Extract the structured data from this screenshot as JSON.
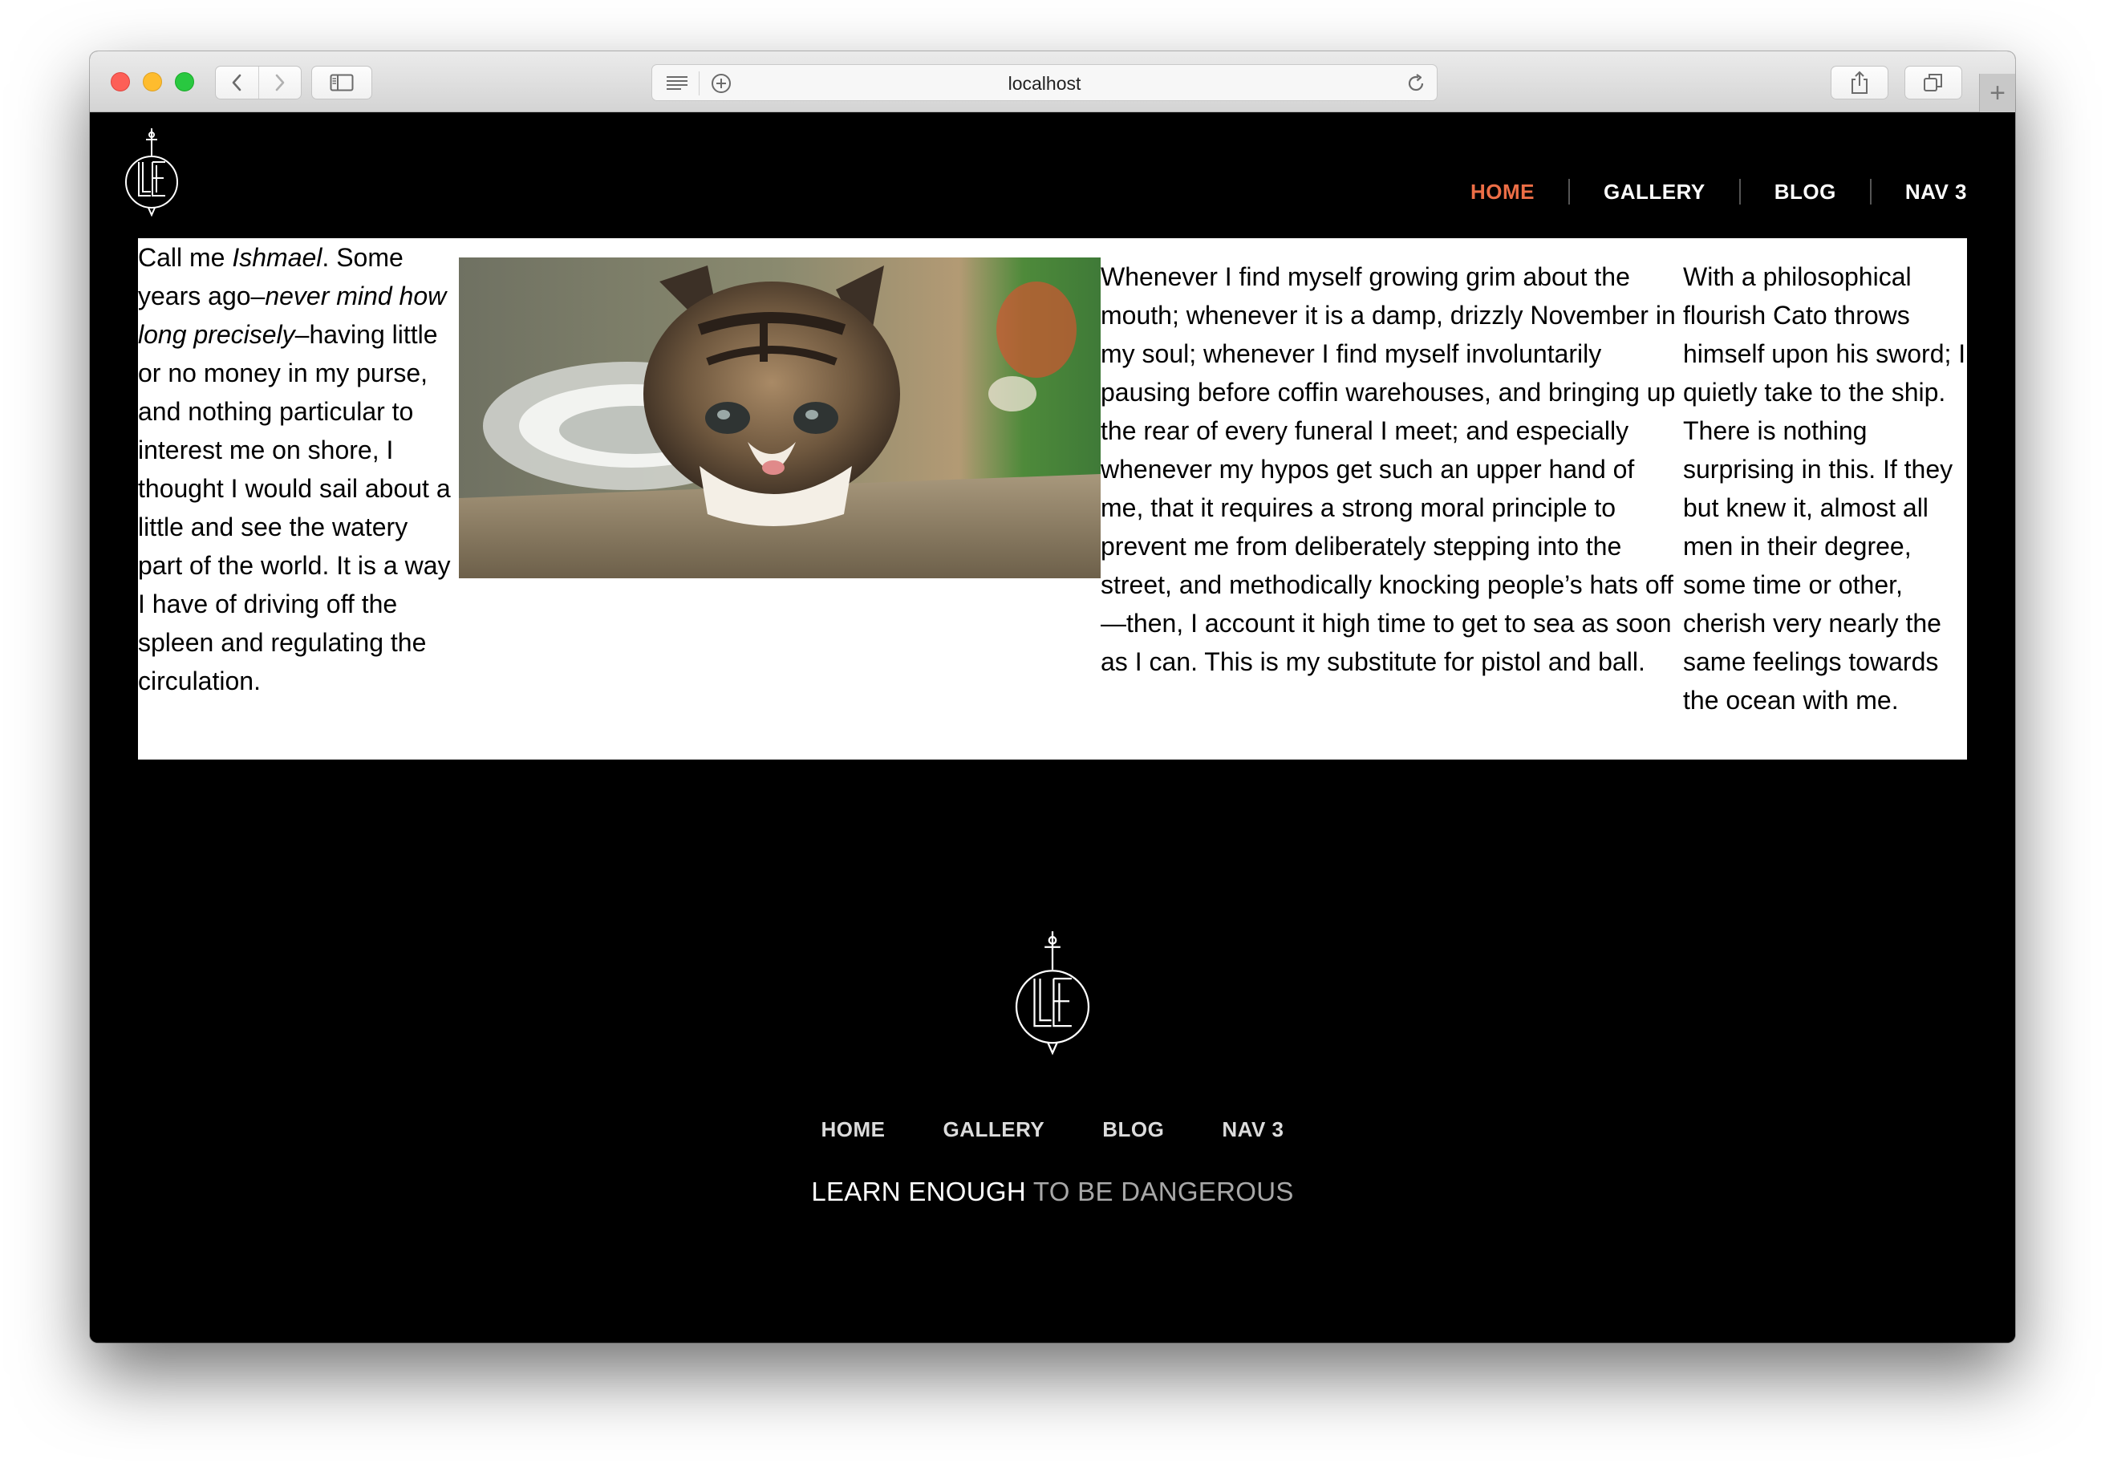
{
  "browser": {
    "url": "localhost",
    "new_tab_label": "+"
  },
  "header": {
    "logo_icon": "le-dagger-logo-icon",
    "nav": [
      {
        "label": "HOME",
        "active": true
      },
      {
        "label": "GALLERY",
        "active": false
      },
      {
        "label": "BLOG",
        "active": false
      },
      {
        "label": "NAV 3",
        "active": false
      }
    ],
    "active_color": "#ed6e46"
  },
  "content": {
    "col1": {
      "p1": "Call me ",
      "p_italic1": "Ishmael",
      "p2": ". Some years ago–",
      "p_italic2": "never mind how long precisely",
      "p3": "–having little or no money in my purse, and nothing particular to interest me on shore, I thought I would sail about a little and see the watery part of the world. It is a way I have of driving off the spleen and regulating the circulation."
    },
    "image_icon": "kitten-photo",
    "col2": "Whenever I find myself growing grim about the mouth; whenever it is a damp, drizzly November in my soul; whenever I find myself involuntarily pausing before coffin warehouses, and bringing up the rear of every funeral I meet; and especially whenever my hypos get such an upper hand of me, that it requires a strong moral principle to prevent me from deliberately stepping into the street, and methodically knocking people’s hats off—then, I account it high time to get to sea as soon as I can. This is my substitute for pistol and ball.",
    "col3": "With a philosophical flourish Cato throws himself upon his sword; I quietly take to the ship. There is nothing surprising in this. If they but knew it, almost all men in their degree, some time or other, cherish very nearly the same feelings towards the ocean with me."
  },
  "footer": {
    "logo_icon": "le-dagger-logo-icon",
    "nav": [
      "HOME",
      "GALLERY",
      "BLOG",
      "NAV 3"
    ],
    "tagline_strong": "LEARN ENOUGH",
    "tagline_light": " TO BE DANGEROUS"
  }
}
